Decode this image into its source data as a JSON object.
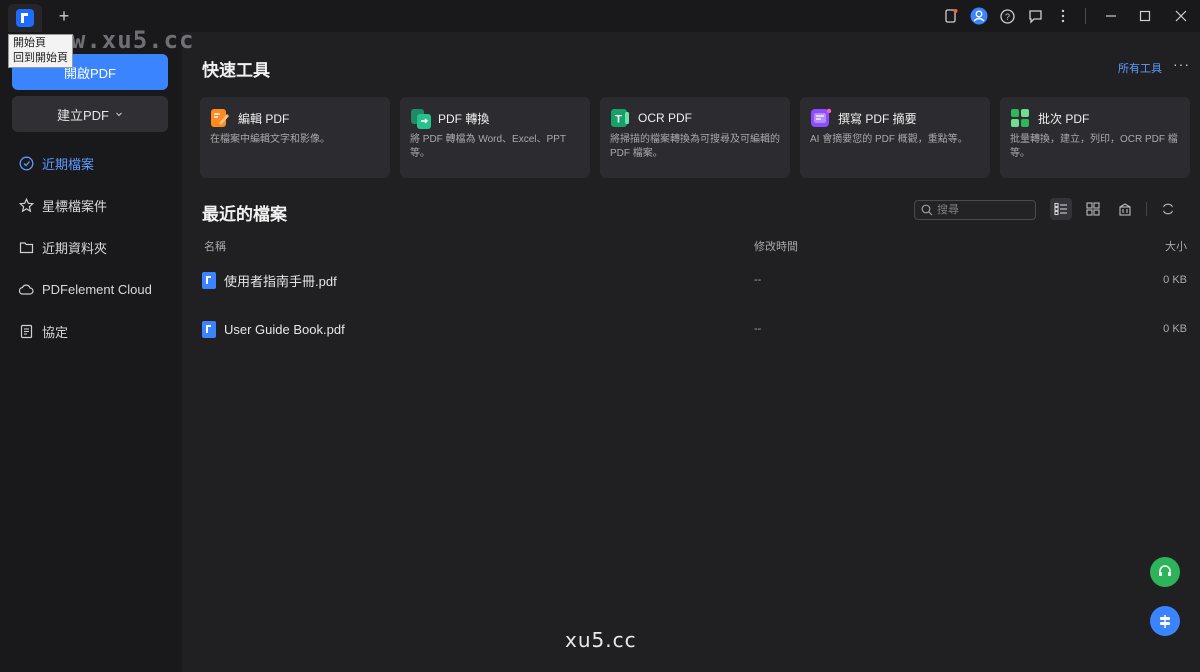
{
  "titlebar": {
    "tooltip_line1": "開始頁",
    "tooltip_line2": "回到開始頁",
    "watermark": "www.xu5.cc"
  },
  "sidebar": {
    "open_pdf": "開啟PDF",
    "create_pdf": "建立PDF",
    "items": [
      {
        "label": "近期檔案",
        "icon": "clock-icon",
        "active": true
      },
      {
        "label": "星標檔案件",
        "icon": "star-icon",
        "active": false
      },
      {
        "label": "近期資料夾",
        "icon": "folder-icon",
        "active": false
      },
      {
        "label": "PDFelement Cloud",
        "icon": "cloud-icon",
        "active": false
      },
      {
        "label": "協定",
        "icon": "document-icon",
        "active": false
      }
    ]
  },
  "quick_tools": {
    "title": "快速工具",
    "all_tools": "所有工具",
    "tools": [
      {
        "name": "編輯 PDF",
        "desc": "在檔案中編輯文字和影像。",
        "color": "#ff8a1f"
      },
      {
        "name": "PDF 轉換",
        "desc": "將 PDF 轉檔為 Word、Excel、PPT 等。",
        "color": "#1fa37a"
      },
      {
        "name": "OCR PDF",
        "desc": "將掃描的檔案轉換為可搜尋及可編輯的 PDF 檔案。",
        "color": "#17a06a"
      },
      {
        "name": "撰寫 PDF 摘要",
        "desc": "AI 會摘要您的 PDF 概觀，重點等。",
        "color": "#8a4dff"
      },
      {
        "name": "批次 PDF",
        "desc": "批量轉換，建立，列印，OCR PDF 檔等。",
        "color": "#2fb65a"
      }
    ]
  },
  "recent": {
    "title": "最近的檔案",
    "search_placeholder": "搜尋",
    "columns": {
      "name": "名稱",
      "modified": "修改時間",
      "size": "大小"
    },
    "files": [
      {
        "name": "使用者指南手冊.pdf",
        "modified": "--",
        "size": "0 KB"
      },
      {
        "name": "User Guide Book.pdf",
        "modified": "--",
        "size": "0 KB"
      }
    ]
  },
  "footer": {
    "watermark": "xu5.cc",
    "support_color": "#2db45a",
    "community_color": "#3a84ff"
  }
}
